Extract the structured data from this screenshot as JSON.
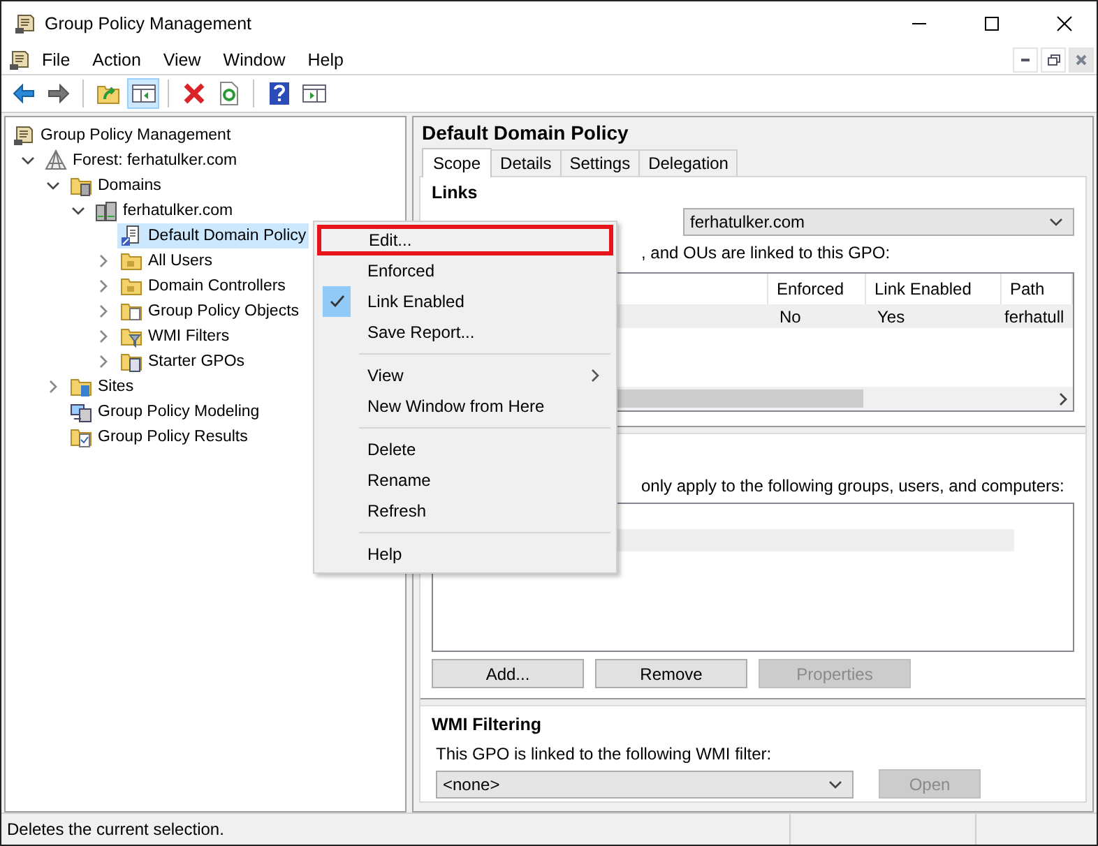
{
  "window": {
    "title": "Group Policy Management"
  },
  "menu_bar": [
    "File",
    "Action",
    "View",
    "Window",
    "Help"
  ],
  "toolbar": [
    [
      {
        "kind": "back",
        "pressed": false
      },
      {
        "kind": "forward",
        "pressed": false
      }
    ],
    [
      {
        "kind": "up",
        "pressed": false
      },
      {
        "kind": "tree-toggle",
        "pressed": true
      }
    ],
    [
      {
        "kind": "delete",
        "pressed": false
      },
      {
        "kind": "refresh",
        "pressed": false
      }
    ],
    [
      {
        "kind": "help",
        "pressed": false
      },
      {
        "kind": "action-pane",
        "pressed": false
      }
    ]
  ],
  "tree": {
    "label": "Group Policy Management",
    "kind": "root",
    "selected": false,
    "children": [
      {
        "label": "Forest: ferhatulker.com",
        "kind": "forest",
        "selected": false,
        "expanded": true,
        "children": [
          {
            "label": "Domains",
            "kind": "domains",
            "selected": false,
            "expanded": true,
            "children": [
              {
                "label": "ferhatulker.com",
                "kind": "domain",
                "selected": false,
                "expanded": true,
                "children": [
                  {
                    "label": "Default Domain Policy",
                    "kind": "gpo-link",
                    "selected": true
                  },
                  {
                    "label": "All Users",
                    "kind": "ou",
                    "selected": false,
                    "expanded": false
                  },
                  {
                    "label": "Domain Controllers",
                    "kind": "ou",
                    "selected": false,
                    "expanded": false
                  },
                  {
                    "label": "Group Policy Objects",
                    "kind": "gpo-folder",
                    "selected": false,
                    "expanded": false
                  },
                  {
                    "label": "WMI Filters",
                    "kind": "wmi",
                    "selected": false,
                    "expanded": false
                  },
                  {
                    "label": "Starter GPOs",
                    "kind": "starter",
                    "selected": false,
                    "expanded": false
                  }
                ]
              }
            ]
          },
          {
            "label": "Sites",
            "kind": "sites",
            "selected": false,
            "expanded": false
          },
          {
            "label": "Group Policy Modeling",
            "kind": "modeling",
            "selected": false
          },
          {
            "label": "Group Policy Results",
            "kind": "results",
            "selected": false
          }
        ]
      }
    ]
  },
  "details": {
    "title": "Default Domain Policy",
    "tabs": [
      {
        "label": "Scope",
        "selected": true
      },
      {
        "label": "Details",
        "selected": false
      },
      {
        "label": "Settings",
        "selected": false
      },
      {
        "label": "Delegation",
        "selected": false
      }
    ],
    "links": {
      "heading": "Links",
      "location": "ferhatulker.com",
      "caption": ", and OUs are linked to this GPO:",
      "columns": [
        "Enforced",
        "Link Enabled",
        "Path"
      ],
      "rows": [
        {
          "cells": [
            "No",
            "Yes",
            "ferhatull"
          ],
          "selected": true
        }
      ]
    },
    "security": {
      "caption": "only apply to the following groups, users, and computers:",
      "buttons": [
        {
          "label": "Add...",
          "disabled": false
        },
        {
          "label": "Remove",
          "disabled": false
        },
        {
          "label": "Properties",
          "disabled": true
        }
      ]
    },
    "wmi": {
      "heading": "WMI Filtering",
      "caption": "This GPO is linked to the following WMI filter:",
      "filter": "<none>",
      "open_button": {
        "label": "Open",
        "disabled": true
      }
    }
  },
  "context_menu": [
    {
      "kind": "item",
      "label": "Edit...",
      "checked": false,
      "outlined": true,
      "submenu": false
    },
    {
      "kind": "item",
      "label": "Enforced",
      "checked": false,
      "outlined": false,
      "submenu": false
    },
    {
      "kind": "item",
      "label": "Link Enabled",
      "checked": true,
      "outlined": false,
      "submenu": false
    },
    {
      "kind": "item",
      "label": "Save Report...",
      "checked": false,
      "outlined": false,
      "submenu": false
    },
    {
      "kind": "separator"
    },
    {
      "kind": "item",
      "label": "View",
      "checked": false,
      "outlined": false,
      "submenu": true
    },
    {
      "kind": "item",
      "label": "New Window from Here",
      "checked": false,
      "outlined": false,
      "submenu": false
    },
    {
      "kind": "separator"
    },
    {
      "kind": "item",
      "label": "Delete",
      "checked": false,
      "outlined": false,
      "submenu": false
    },
    {
      "kind": "item",
      "label": "Rename",
      "checked": false,
      "outlined": false,
      "submenu": false
    },
    {
      "kind": "item",
      "label": "Refresh",
      "checked": false,
      "outlined": false,
      "submenu": false
    },
    {
      "kind": "separator"
    },
    {
      "kind": "item",
      "label": "Help",
      "checked": false,
      "outlined": false,
      "submenu": false
    }
  ],
  "status_bar": "Deletes the current selection."
}
